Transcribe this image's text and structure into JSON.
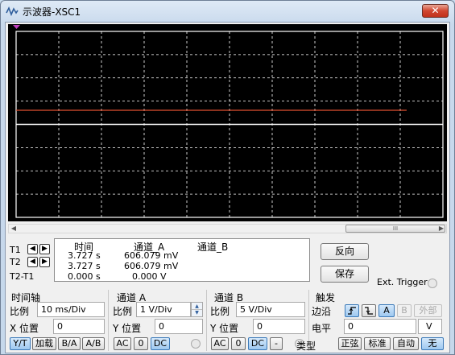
{
  "window": {
    "title": "示波器-XSC1",
    "close_label": "✕"
  },
  "cursors": {
    "t1": "T1",
    "t2": "T2",
    "t2t1": "T2-T1"
  },
  "measurements": {
    "headers": {
      "time": "时间",
      "channel_a": "通道_A",
      "channel_b": "通道_B"
    },
    "rows": [
      {
        "time": "3.727 s",
        "a": "606.079 mV",
        "b": ""
      },
      {
        "time": "3.727 s",
        "a": "606.079 mV",
        "b": ""
      },
      {
        "time": "0.000 s",
        "a": "0.000 V",
        "b": ""
      }
    ]
  },
  "buttons": {
    "reverse": "反向",
    "save": "保存",
    "ext_trigger": "Ext. Trigger"
  },
  "timebase": {
    "title": "时间轴",
    "scale_label": "比例",
    "scale_value": "10 ms/Div",
    "xpos_label": "X 位置",
    "xpos_value": "0",
    "modes": [
      "Y/T",
      "加载",
      "B/A",
      "A/B"
    ]
  },
  "channel_a": {
    "title": "通道 A",
    "scale_label": "比例",
    "scale_value": "1  V/Div",
    "ypos_label": "Y 位置",
    "ypos_value": "0",
    "coupling": [
      "AC",
      "0",
      "DC"
    ]
  },
  "channel_b": {
    "title": "通道 B",
    "scale_label": "比例",
    "scale_value": "5  V/Div",
    "ypos_label": "Y 位置",
    "ypos_value": "0",
    "coupling": [
      "AC",
      "0",
      "DC",
      "-"
    ]
  },
  "trigger": {
    "title": "触发",
    "edge_label": "边沿",
    "edges": [
      "A",
      "B",
      "外部"
    ],
    "level_label": "电平",
    "level_value": "0",
    "level_unit": "V",
    "type_label": "类型",
    "types": [
      "正弦",
      "标准",
      "自动",
      "无"
    ]
  },
  "scrollbar": {
    "thumb_grip": "III"
  },
  "display": {
    "trace_a_volts": 0.606,
    "volts_per_div": 1,
    "grid_cols": 10,
    "grid_rows": 8
  },
  "colors": {
    "trace_a": "#e05030",
    "grid": "#ffffff",
    "screen": "#000000",
    "accent": "#3b79b8"
  }
}
